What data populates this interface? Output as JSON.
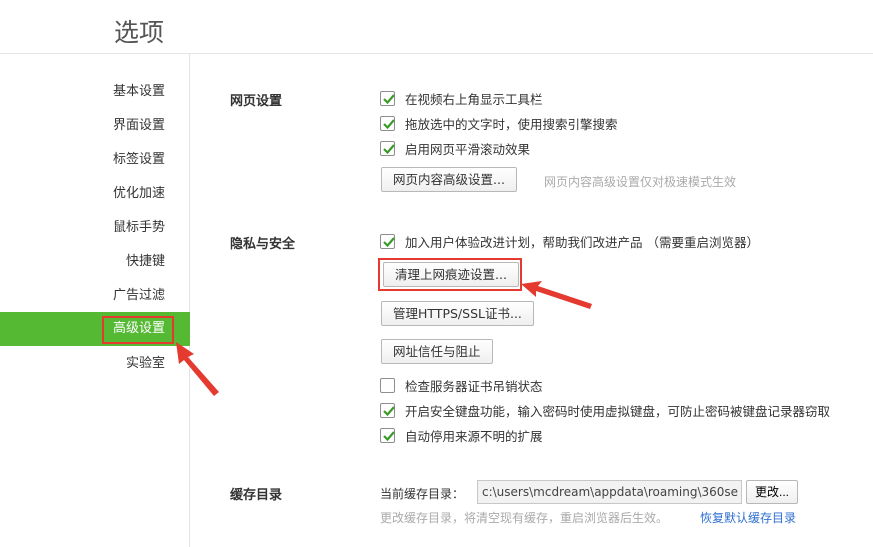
{
  "header": {
    "title": "选项"
  },
  "sidebar": {
    "items": [
      {
        "label": "基本设置"
      },
      {
        "label": "界面设置"
      },
      {
        "label": "标签设置"
      },
      {
        "label": "优化加速"
      },
      {
        "label": "鼠标手势"
      },
      {
        "label": "快捷键"
      },
      {
        "label": "广告过滤"
      },
      {
        "label": "高级设置"
      },
      {
        "label": "实验室"
      }
    ],
    "active_index": 7,
    "active_color": "#55b934"
  },
  "web": {
    "title": "网页设置",
    "options": [
      {
        "label": "在视频右上角显示工具栏",
        "checked": true
      },
      {
        "label": "拖放选中的文字时，使用搜索引擎搜索",
        "checked": true
      },
      {
        "label": "启用网页平滑滚动效果",
        "checked": true
      }
    ],
    "advanced_button": "网页内容高级设置...",
    "advanced_hint": "网页内容高级设置仅对极速模式生效"
  },
  "privacy": {
    "title": "隐私与安全",
    "ux_option": {
      "label": "加入用户体验改进计划，帮助我们改进产品 （需要重启浏览器）",
      "checked": true
    },
    "clear_button": "清理上网痕迹设置...",
    "https_button": "管理HTTPS/SSL证书...",
    "trust_button": "网址信任与阻止",
    "options": [
      {
        "label": "检查服务器证书吊销状态",
        "checked": false
      },
      {
        "label": "开启安全键盘功能，输入密码时使用虚拟键盘，可防止密码被键盘记录器窃取",
        "checked": true
      },
      {
        "label": "自动停用来源不明的扩展",
        "checked": true
      }
    ]
  },
  "cache": {
    "title": "缓存目录",
    "current_label": "当前缓存目录：",
    "path_value": "c:\\users\\mcdream\\appdata\\roaming\\360se",
    "change_button": "更改...",
    "hint": "更改缓存目录，将清空现有缓存，重启浏览器后生效。",
    "restore_link": "恢复默认缓存目录"
  },
  "colors": {
    "accent": "#55b934",
    "highlight": "#e43a2f",
    "check": "#3a9a2a",
    "link": "#2f6fd0"
  }
}
